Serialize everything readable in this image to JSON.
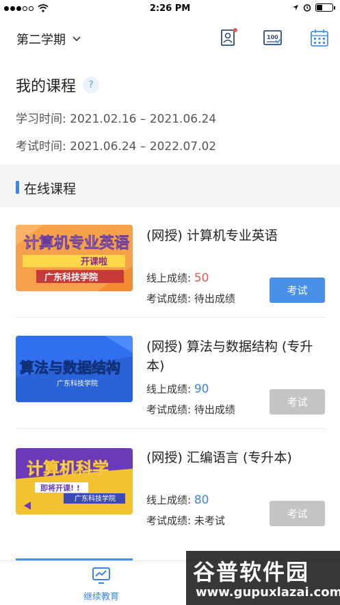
{
  "status_bar": {
    "time": "2:26 PM"
  },
  "header": {
    "semester_label": "第二学期",
    "icons": [
      "profile-card-icon",
      "score-report-icon",
      "calendar-icon"
    ]
  },
  "info": {
    "title": "我的课程",
    "help": "?",
    "study_time": "学习时间: 2021.02.16 – 2021.06.24",
    "exam_time": "考试时间: 2021.06.24 – 2022.07.02"
  },
  "online": {
    "title": "在线课程",
    "courses": [
      {
        "name": "(网授) 计算机专业英语",
        "online_label": "线上成绩: ",
        "online_score": "50",
        "exam_label": "考试成绩: ",
        "exam_score": "待出成绩",
        "button": "考试",
        "thumb": {
          "title": "计算机专业英语",
          "ribbon": "开课啦",
          "school": "广东科技学院",
          "bg_color": "#f7a04a"
        }
      },
      {
        "name": "(网授) 算法与数据结构 (专升本)",
        "online_label": "线上成绩: ",
        "online_score": "90",
        "exam_label": "考试成绩: ",
        "exam_score": "待出成绩",
        "button": "考试",
        "thumb": {
          "title": "算法与数据结构",
          "school": "广东科技学院",
          "bg_color": "#2f6ff0"
        }
      },
      {
        "name": "(网授) 汇编语言 (专升本)",
        "online_label": "线上成绩: ",
        "online_score": "80",
        "exam_label": "考试成绩: ",
        "exam_score": "未考试",
        "button": "考试",
        "thumb": {
          "title": "计算机科学",
          "ribbon": "即将开课! !",
          "school": "广东科技学院",
          "bg_color": "#f2c230"
        }
      }
    ]
  },
  "bottom_nav": {
    "item_label": "继续教育"
  },
  "watermark": {
    "main": "谷普软件园",
    "url": "www.gupuxlazai.com"
  },
  "colors": {
    "accent": "#3a86e4",
    "score_red": "#e25c5c",
    "disabled": "#c4c4c4"
  }
}
